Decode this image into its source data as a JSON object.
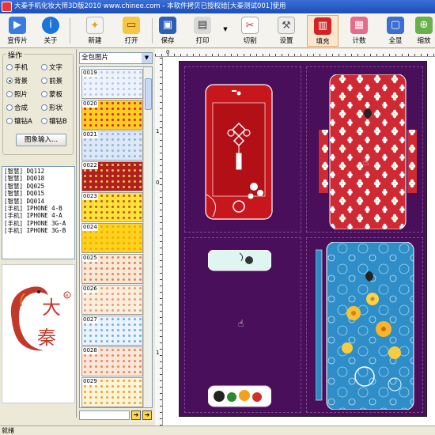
{
  "window": {
    "title": "大秦手机化妆大师3D版2010 www.chinee.com - 本软件拷贝已授权给[大秦测试001]使用"
  },
  "toolbar": {
    "buttons": [
      {
        "label": "宣传片",
        "icon": "film-icon"
      },
      {
        "label": "关于",
        "icon": "info-icon"
      },
      {
        "label": "新建",
        "icon": "new-file-icon"
      },
      {
        "label": "打开",
        "icon": "folder-open-icon"
      },
      {
        "label": "保存",
        "icon": "save-icon"
      },
      {
        "label": "打印",
        "icon": "printer-icon"
      },
      {
        "label": "切割",
        "icon": "cut-icon"
      },
      {
        "label": "设置",
        "icon": "tools-icon"
      },
      {
        "label": "填充",
        "icon": "fill-icon"
      },
      {
        "label": "计数",
        "icon": "calculator-icon"
      },
      {
        "label": "全显",
        "icon": "fullscreen-icon"
      },
      {
        "label": "缩放",
        "icon": "zoom-icon"
      }
    ],
    "active": "填充"
  },
  "operations": {
    "title": "操作",
    "options": [
      "手机",
      "文字",
      "背景",
      "前景",
      "照片",
      "蒙板",
      "合成",
      "形状",
      "镶钻A",
      "镶钻B"
    ],
    "selected": "背景",
    "image_input_button": "图象输入..."
  },
  "models": [
    "[智慧] DQ112",
    "[智慧] DQ018",
    "[智慧] DQ025",
    "[智慧] DQ015",
    "[智慧] DQ014",
    "[手机] IPHONE 4-B",
    "[手机] IPHONE 4-A",
    "[手机] IPHONE 3G-A",
    "[手机] IPHONE 3G-B"
  ],
  "logo": {
    "text_top": "大",
    "text_bottom": "秦",
    "mark": "R"
  },
  "gallery": {
    "category": "全包图片",
    "tiles": [
      {
        "num": "0019",
        "color": "#eef3ff",
        "pattern": "#b8c8e6"
      },
      {
        "num": "0020",
        "color": "#ffcc22",
        "pattern": "#d12a2a"
      },
      {
        "num": "0021",
        "color": "#dce8f8",
        "pattern": "#98b4d8"
      },
      {
        "num": "0022",
        "color": "#b02020",
        "pattern": "#f0c040"
      },
      {
        "num": "0023",
        "color": "#ffe23a",
        "pattern": "#c65a10"
      },
      {
        "num": "0024",
        "color": "#ffd21e",
        "pattern": "#f6a800"
      },
      {
        "num": "0025",
        "color": "#fbe8d4",
        "pattern": "#d88868"
      },
      {
        "num": "0026",
        "color": "#fdeedc",
        "pattern": "#e2a080"
      },
      {
        "num": "0027",
        "color": "#eaf4ff",
        "pattern": "#7aaee0"
      },
      {
        "num": "0028",
        "color": "#fde6d6",
        "pattern": "#d9906a"
      },
      {
        "num": "0029",
        "color": "#fff4d8",
        "pattern": "#e8a838"
      }
    ]
  },
  "ruler": {
    "h_label": "0",
    "v_labels": [
      "1",
      "0",
      "1"
    ]
  },
  "canvas": {
    "sheet_color": "#4a0f5a"
  },
  "status": {
    "text": "就绪"
  }
}
